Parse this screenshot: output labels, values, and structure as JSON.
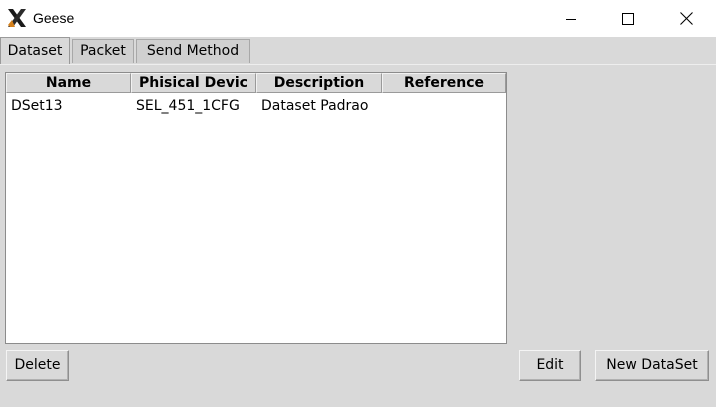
{
  "window": {
    "title": "Geese",
    "icon": "x-logo-icon"
  },
  "tabs": [
    {
      "label": "Dataset",
      "active": true
    },
    {
      "label": "Packet",
      "active": false
    },
    {
      "label": "Send Method",
      "active": false
    }
  ],
  "table": {
    "columns": [
      "Name",
      "Phisical Devic",
      "Description",
      "Reference"
    ],
    "rows": [
      {
        "name": "DSet13",
        "device": "SEL_451_1CFG",
        "description": "Dataset Padrao",
        "reference": ""
      }
    ]
  },
  "buttons": {
    "delete": "Delete",
    "edit": "Edit",
    "new_dataset": "New DataSet"
  }
}
